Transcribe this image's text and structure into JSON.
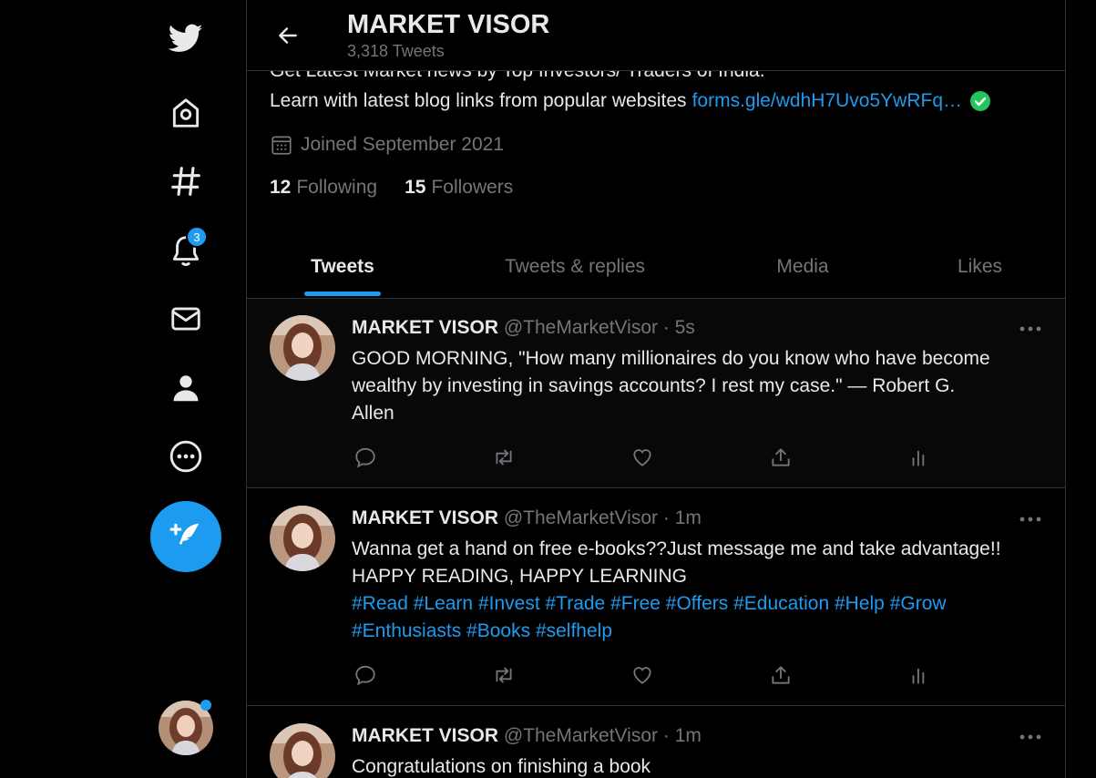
{
  "nav": {
    "items": [
      {
        "name": "twitter-logo-icon"
      },
      {
        "name": "home-icon"
      },
      {
        "name": "explore-hashtag-icon"
      },
      {
        "name": "notifications-bell-icon"
      },
      {
        "name": "messages-envelope-icon"
      },
      {
        "name": "profile-person-icon"
      },
      {
        "name": "more-circle-icon"
      }
    ],
    "notification_count": "3",
    "compose_icon": "compose-feather-icon",
    "accent": "#1d9bf0"
  },
  "header": {
    "title": "MARKET VISOR",
    "tweet_count": "3,318 Tweets"
  },
  "profile": {
    "bio_line1": "Get Latest Market news by Top Investors/ Traders of India.",
    "bio_line2": "Learn with latest blog links from popular websites",
    "bio_link": "forms.gle/wdhH7Uvo5YwRFq…",
    "joined": "Joined September 2021",
    "following_count": "12",
    "following_label": "Following",
    "followers_count": "15",
    "followers_label": "Followers"
  },
  "tabs": [
    {
      "label": "Tweets",
      "active": true
    },
    {
      "label": "Tweets & replies",
      "active": false
    },
    {
      "label": "Media",
      "active": false
    },
    {
      "label": "Likes",
      "active": false
    }
  ],
  "tweets": [
    {
      "name": "MARKET VISOR",
      "handle": "@TheMarketVisor",
      "time": "5s",
      "text_lines": [
        "GOOD MORNING, \"How many millionaires do you know who have become",
        "wealthy by investing in savings accounts? I rest my case.\" — Robert G.",
        "Allen"
      ]
    },
    {
      "name": "MARKET VISOR",
      "handle": "@TheMarketVisor",
      "time": "1m",
      "text_lines": [
        "Wanna get a hand on free e-books??Just message me and take advantage!!",
        "HAPPY READING, HAPPY LEARNING"
      ],
      "hashtag_lines": [
        "#Read #Learn #Invest #Trade #Free #Offers #Education #Help #Grow",
        "#Enthusiasts #Books #selfhelp"
      ]
    },
    {
      "name": "MARKET VISOR",
      "handle": "@TheMarketVisor",
      "time": "1m",
      "text_lines": [
        "Congratulations on finishing a book"
      ]
    }
  ],
  "separator": "·"
}
